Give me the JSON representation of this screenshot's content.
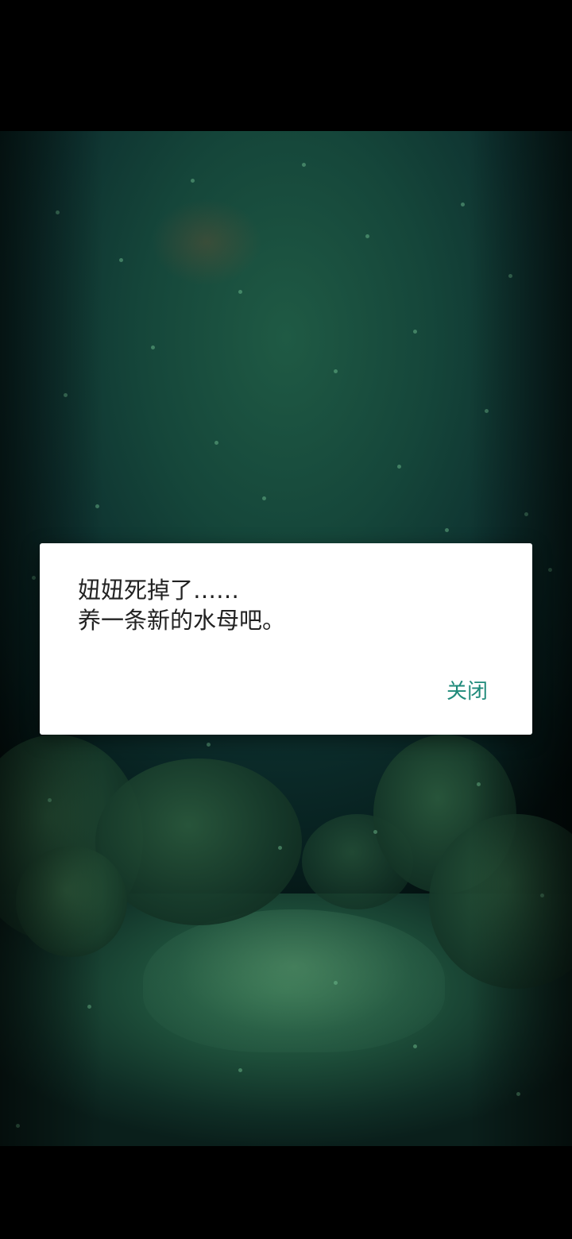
{
  "dialog": {
    "message_line1": "妞妞死掉了……",
    "message_line2": "养一条新的水母吧。",
    "close_label": "关闭"
  },
  "colors": {
    "accent": "#1f8a7a",
    "dialog_bg": "#ffffff",
    "message_text": "#222222",
    "scene_dark": "#07201f",
    "scene_light": "#1f5a44"
  },
  "scene": {
    "background": "underwater-aquarium-scene"
  }
}
